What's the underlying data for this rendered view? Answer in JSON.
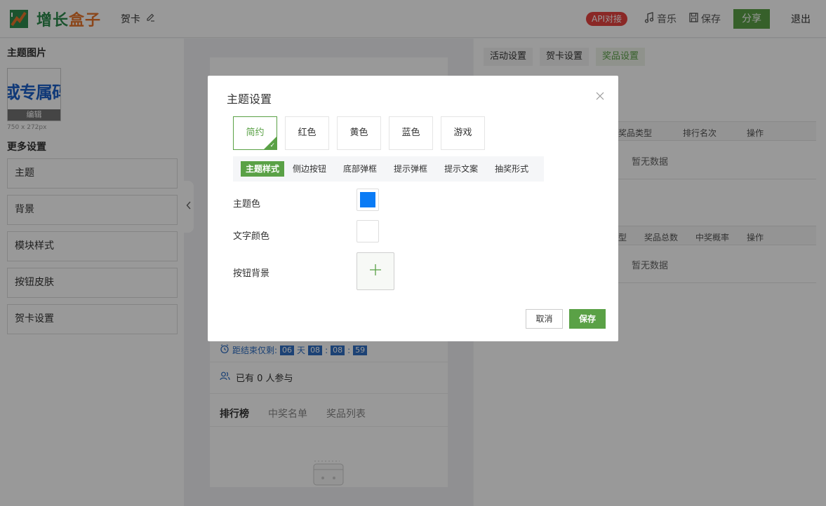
{
  "header": {
    "logo_text_1": "增长",
    "logo_text_2": "盒子",
    "doc_title": "贺卡",
    "api_badge": "API对接",
    "music_label": "音乐",
    "save_label": "保存",
    "share_label": "分享",
    "logout_label": "退出"
  },
  "left": {
    "theme_image_title": "主题图片",
    "theme_image_text": "或专属码",
    "edit_label": "编辑",
    "image_size": "750 x 272px",
    "more_title": "更多设置",
    "items": [
      {
        "label": "主题"
      },
      {
        "label": "背景"
      },
      {
        "label": "模块样式"
      },
      {
        "label": "按钮皮肤"
      },
      {
        "label": "贺卡设置"
      }
    ]
  },
  "preview": {
    "countdown_label": "距结束仅剩:",
    "days": "06",
    "day_unit": "天",
    "hours": "08",
    "minutes": "08",
    "seconds": "59",
    "participants": "已有 0 人参与",
    "tabs": [
      {
        "label": "排行榜"
      },
      {
        "label": "中奖名单"
      },
      {
        "label": "奖品列表"
      }
    ]
  },
  "right": {
    "tabs": [
      {
        "label": "活动设置"
      },
      {
        "label": "贺卡设置"
      },
      {
        "label": "奖品设置"
      }
    ],
    "table1_headers": [
      "奖品类型",
      "排行名次",
      "操作"
    ],
    "table2_headers": [
      "型",
      "奖品总数",
      "中奖概率",
      "操作"
    ],
    "empty_text": "暂无数据"
  },
  "modal": {
    "title": "主题设置",
    "themes": [
      {
        "label": "简约"
      },
      {
        "label": "红色"
      },
      {
        "label": "黄色"
      },
      {
        "label": "蓝色"
      },
      {
        "label": "游戏"
      }
    ],
    "subtabs": [
      {
        "label": "主题样式"
      },
      {
        "label": "侧边按钮"
      },
      {
        "label": "底部弹框"
      },
      {
        "label": "提示弹框"
      },
      {
        "label": "提示文案"
      },
      {
        "label": "抽奖形式"
      }
    ],
    "theme_color_label": "主题色",
    "text_color_label": "文字颜色",
    "button_bg_label": "按钮背景",
    "cancel_label": "取消",
    "save_label": "保存"
  },
  "colors": {
    "accent_green": "#5aa146",
    "theme_color": "#0a7bf5",
    "text_color": "#ffffff",
    "api_red": "#e64340"
  }
}
